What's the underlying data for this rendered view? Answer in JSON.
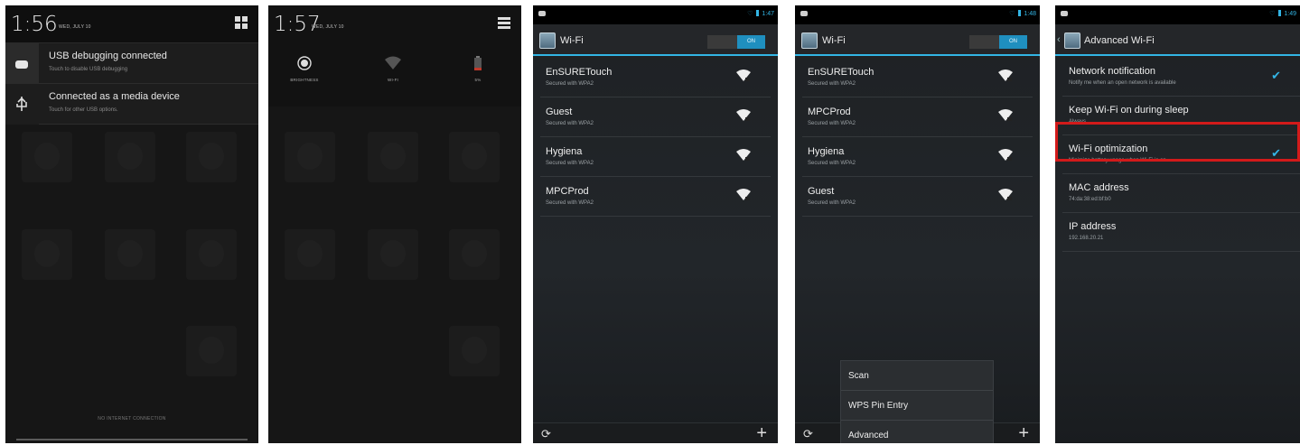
{
  "panel1": {
    "time": "1:56",
    "date": "WED, JULY 10",
    "notifications": [
      {
        "title": "USB debugging connected",
        "subtitle": "Touch to disable USB debugging",
        "icon": "android-debug-icon"
      },
      {
        "title": "Connected as a media device",
        "subtitle": "Touch for other USB options.",
        "icon": "usb-icon"
      }
    ],
    "footer": "NO INTERNET CONNECTION"
  },
  "panel2": {
    "time": "1:57",
    "date": "WED, JULY 10",
    "quick_settings": [
      {
        "label": "BRIGHTNESS",
        "icon": "brightness-icon"
      },
      {
        "label": "WI-FI",
        "icon": "wifi-icon"
      },
      {
        "label": "5%",
        "icon": "battery-icon"
      }
    ]
  },
  "panel3": {
    "status_time": "1:47",
    "title": "Wi-Fi",
    "toggle": "ON",
    "networks": [
      {
        "name": "EnSURETouch",
        "security": "Secured with WPA2"
      },
      {
        "name": "Guest",
        "security": "Secured with WPA2"
      },
      {
        "name": "Hygiena",
        "security": "Secured with WPA2"
      },
      {
        "name": "MPCProd",
        "security": "Secured with WPA2"
      }
    ]
  },
  "panel4": {
    "status_time": "1:48",
    "title": "Wi-Fi",
    "toggle": "ON",
    "networks": [
      {
        "name": "EnSURETouch",
        "security": "Secured with WPA2"
      },
      {
        "name": "MPCProd",
        "security": "Secured with WPA2"
      },
      {
        "name": "Hygiena",
        "security": "Secured with WPA2"
      },
      {
        "name": "Guest",
        "security": "Secured with WPA2"
      }
    ],
    "menu": [
      "Scan",
      "WPS Pin Entry",
      "Advanced"
    ]
  },
  "panel5": {
    "status_time": "1:49",
    "title": "Advanced Wi-Fi",
    "settings": [
      {
        "title": "Network notification",
        "summary": "Notify me when an open network is available",
        "checked": true
      },
      {
        "title": "Keep Wi-Fi on during sleep",
        "summary": "Always",
        "checked": false
      },
      {
        "title": "Wi-Fi optimization",
        "summary": "Minimize battery usage when Wi-Fi is on",
        "checked": true
      },
      {
        "title": "MAC address",
        "summary": "74:da:38:ed:bf:b0",
        "checked": false
      },
      {
        "title": "IP address",
        "summary": "192.168.20.21",
        "checked": false
      }
    ],
    "highlight_color": "#d21a1a"
  },
  "colors": {
    "accent": "#33b5e5"
  }
}
